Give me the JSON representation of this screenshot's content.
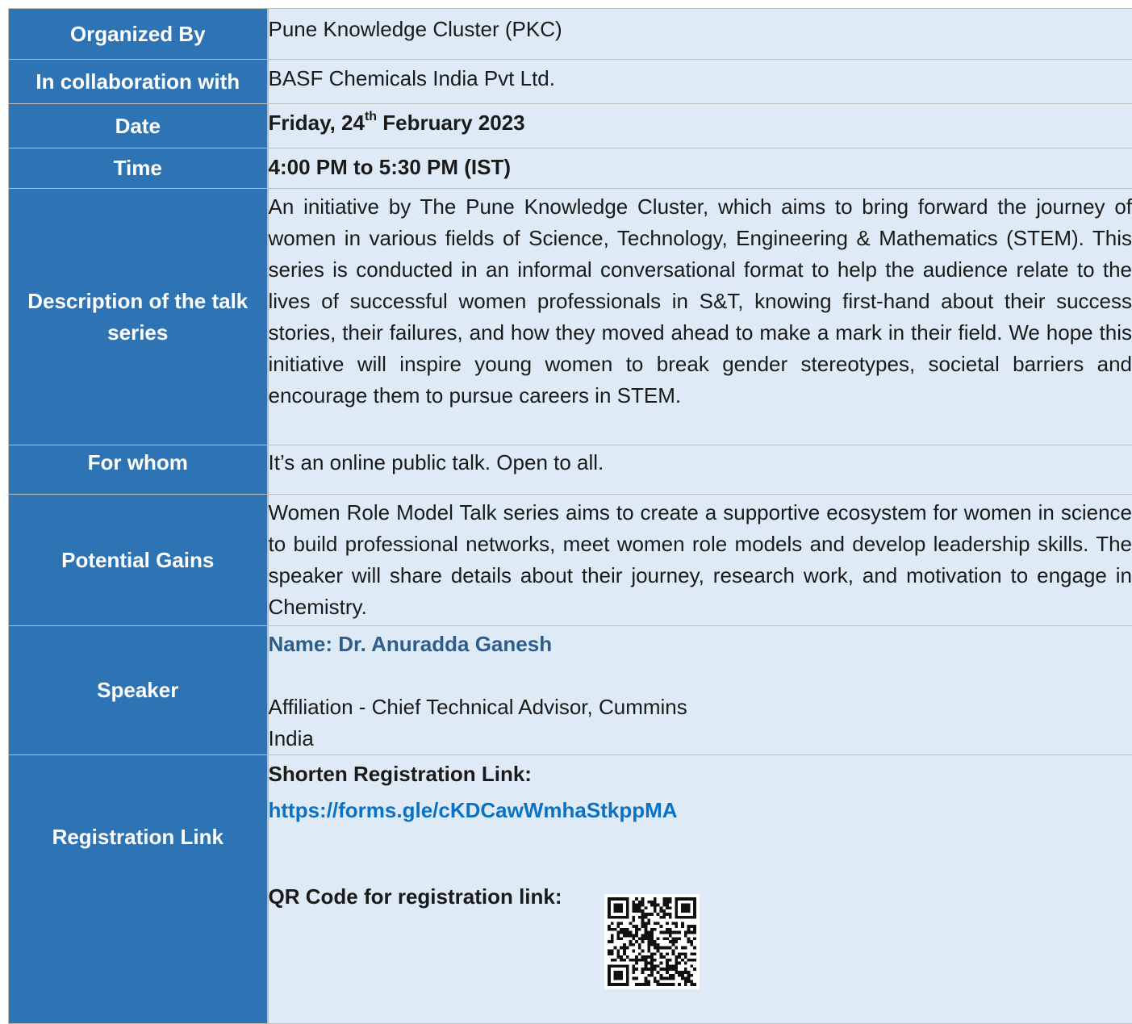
{
  "rows": {
    "organized_by": {
      "label": "Organized By",
      "value": "Pune Knowledge Cluster (PKC)"
    },
    "collaboration": {
      "label": "In collaboration with",
      "value": "BASF Chemicals India Pvt Ltd."
    },
    "date": {
      "label": "Date",
      "value_pre": "Friday, 24",
      "value_sup": "th",
      "value_post": " February 2023"
    },
    "time": {
      "label": "Time",
      "value": "4:00 PM to 5:30 PM (IST)"
    },
    "description": {
      "label": "Description of the talk series",
      "value": "An initiative by The Pune Knowledge Cluster, which aims to bring forward the journey of women in various fields of Science, Technology, Engineering & Mathematics (STEM). This series is conducted in an informal conversational format to help the audience relate to the lives of successful women professionals in S&T, knowing first-hand about their success stories, their failures, and how they moved ahead to make a mark in their field. We hope this initiative will inspire young women to break gender stereotypes, societal barriers and encourage them to pursue careers in STEM."
    },
    "for_whom": {
      "label": "For whom",
      "value": "It’s an online public talk. Open to all."
    },
    "gains": {
      "label": "Potential Gains",
      "value": "Women Role Model Talk series aims to create a supportive ecosystem for women in science to build professional networks, meet women role models and develop leadership skills. The speaker will share details about their journey, research work, and motivation to engage in Chemistry."
    },
    "speaker": {
      "label": "Speaker",
      "name": "Name: Dr. Anuradda Ganesh",
      "affiliation_line1": "Affiliation - Chief Technical Advisor, Cummins",
      "affiliation_line2": "India"
    },
    "registration": {
      "label": "Registration Link",
      "link_heading": "Shorten Registration Link:",
      "link_url": "https://forms.gle/cKDCawWmhaStkppMA",
      "qr_heading": "QR Code for registration link:"
    }
  },
  "colors": {
    "label_bg": "#2e74b5",
    "value_bg": "#deebf7",
    "link": "#0a72c4",
    "speaker_name": "#2e5d8a"
  },
  "icons": {
    "qr": "qr-code-icon"
  }
}
